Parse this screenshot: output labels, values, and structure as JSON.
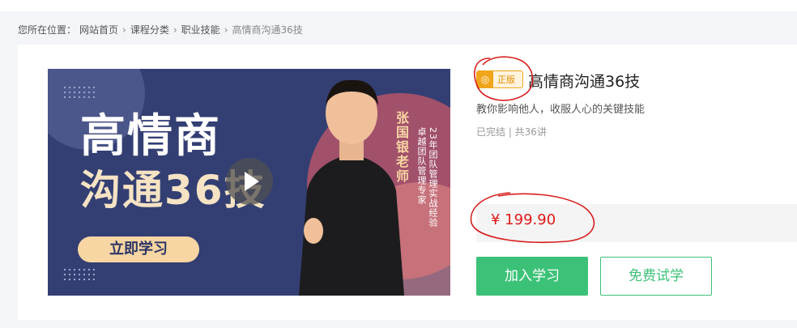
{
  "breadcrumb": {
    "prefix": "您所在位置：",
    "items": [
      "网站首页",
      "课程分类",
      "职业技能",
      "高情商沟通36技"
    ]
  },
  "banner": {
    "title_line1": "高情商",
    "title_line2": "沟通36技",
    "cta": "立即学习",
    "teacher": "张国银老师",
    "tagline1": "23年团队管理实战经验",
    "tagline2": "卓越团队管理专家",
    "play_icon": "play-icon"
  },
  "course": {
    "badge": "正版",
    "title": "高情商沟通36技",
    "subtitle": "教你影响他人，收服人心的关键技能",
    "status": "已完结 | 共36讲",
    "price": "¥ 199.90",
    "join_label": "加入学习",
    "trial_label": "免费试学"
  },
  "colors": {
    "accent_green": "#3cc278",
    "price_red": "#e11818",
    "badge_orange": "#f1a51a"
  }
}
